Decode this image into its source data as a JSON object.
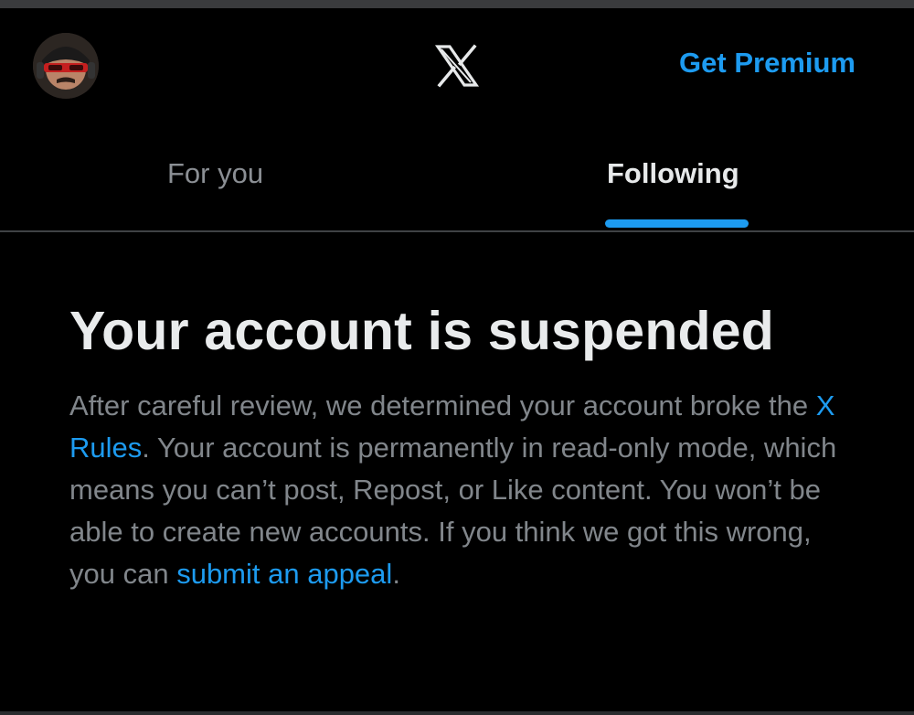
{
  "header": {
    "avatar_alt": "profile avatar",
    "logo_icon": "x-logo-icon",
    "premium_label": "Get Premium"
  },
  "tabs": [
    {
      "label": "For you",
      "selected": false
    },
    {
      "label": "Following",
      "selected": true
    }
  ],
  "notice": {
    "title": "Your account is suspended",
    "body_part1": "After careful review, we determined your account broke the ",
    "rules_link": "X Rules",
    "body_part2": ". Your account is permanently in read-only mode, which means you can’t post, Repost, or Like content. You won’t be able to create new accounts. If you think we got this wrong, you can ",
    "appeal_link": "submit an appeal",
    "body_part3": "."
  },
  "colors": {
    "accent": "#1d9bf0",
    "background": "#000000",
    "text_primary": "#e7e9ea",
    "text_secondary": "#81868b"
  }
}
